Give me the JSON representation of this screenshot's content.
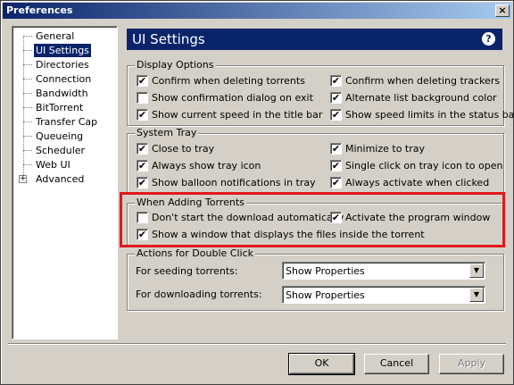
{
  "window": {
    "title": "Preferences",
    "close_glyph": "×"
  },
  "tree": {
    "items": [
      {
        "label": "General"
      },
      {
        "label": "UI Settings",
        "selected": true
      },
      {
        "label": "Directories"
      },
      {
        "label": "Connection"
      },
      {
        "label": "Bandwidth"
      },
      {
        "label": "BitTorrent"
      },
      {
        "label": "Transfer Cap"
      },
      {
        "label": "Queueing"
      },
      {
        "label": "Scheduler"
      },
      {
        "label": "Web UI"
      },
      {
        "label": "Advanced",
        "expandable": true
      }
    ],
    "expander_glyph": "+"
  },
  "header": {
    "title": "UI Settings",
    "help_glyph": "?"
  },
  "display_options": {
    "title": "Display Options",
    "items": [
      {
        "label": "Confirm when deleting torrents",
        "checked": true
      },
      {
        "label": "Confirm when deleting trackers",
        "checked": true
      },
      {
        "label": "Show confirmation dialog on exit",
        "checked": false
      },
      {
        "label": "Alternate list background color",
        "checked": true
      },
      {
        "label": "Show current speed in the title bar",
        "checked": true
      },
      {
        "label": "Show speed limits in the status bar",
        "checked": true
      }
    ]
  },
  "system_tray": {
    "title": "System Tray",
    "items": [
      {
        "label": "Close to tray",
        "checked": true
      },
      {
        "label": "Minimize to tray",
        "checked": true
      },
      {
        "label": "Always show tray icon",
        "checked": true
      },
      {
        "label": "Single click on tray icon to open",
        "checked": true
      },
      {
        "label": "Show balloon notifications in tray",
        "checked": true
      },
      {
        "label": "Always activate when clicked",
        "checked": true
      }
    ]
  },
  "adding_torrents": {
    "title": "When Adding Torrents",
    "items": [
      {
        "label": "Don't start the download automatically",
        "checked": false
      },
      {
        "label": "Activate the program window",
        "checked": true
      },
      {
        "label": "Show a window that displays the files inside the torrent",
        "checked": true
      }
    ]
  },
  "double_click": {
    "title": "Actions for Double Click",
    "seeding_label": "For seeding torrents:",
    "seeding_value": "Show Properties",
    "downloading_label": "For downloading torrents:",
    "downloading_value": "Show Properties"
  },
  "buttons": {
    "ok": "OK",
    "cancel": "Cancel",
    "apply": "Apply"
  },
  "check_glyph": "✔",
  "colors": {
    "highlight": "#e0171b",
    "banner": "#0a246a"
  }
}
